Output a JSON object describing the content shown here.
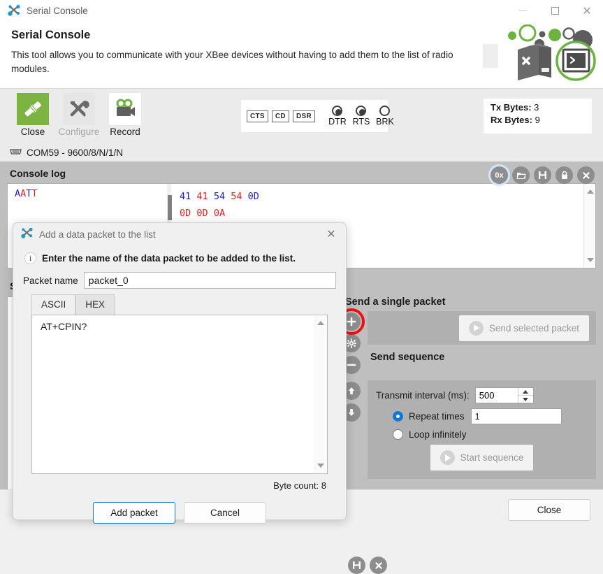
{
  "window": {
    "title": "Serial Console",
    "app_icon": "molecule-icon",
    "minimize": "minimize-icon",
    "maximize": "maximize-icon",
    "close": "close-icon"
  },
  "header": {
    "title": "Serial Console",
    "description": "This tool allows you to communicate with your XBee devices without having to add them to the list of radio modules.",
    "art_accent_green": "#6cb33f",
    "art_grey": "#5a5a5a"
  },
  "toolbar": {
    "buttons": [
      {
        "label": "Close",
        "icon": "disconnect-plug-icon",
        "enabled": true
      },
      {
        "label": "Configure",
        "icon": "tools-icon",
        "enabled": false
      },
      {
        "label": "Record",
        "icon": "video-camera-icon",
        "enabled": true
      }
    ],
    "signals": {
      "chips": [
        "CTS",
        "CD",
        "DSR"
      ],
      "leds": [
        {
          "label": "DTR",
          "on": true
        },
        {
          "label": "RTS",
          "on": true
        },
        {
          "label": "BRK",
          "on": false
        }
      ]
    },
    "counters": {
      "tx_label": "Tx Bytes:",
      "tx_value": "3",
      "rx_label": "Rx Bytes:",
      "rx_value": "9"
    },
    "port_status": "COM59 - 9600/8/N/1/N",
    "port_icon": "serial-port-icon"
  },
  "console_log": {
    "title": "Console log",
    "tools": [
      {
        "name": "hex-toggle",
        "glyph": "0x",
        "selected": true
      },
      {
        "name": "open-folder",
        "glyph": "folder",
        "selected": false
      },
      {
        "name": "save-log",
        "glyph": "floppy",
        "selected": false
      },
      {
        "name": "lock-scroll",
        "glyph": "lock",
        "selected": false
      },
      {
        "name": "clear-log",
        "glyph": "x",
        "selected": false
      }
    ],
    "ascii_chars": [
      {
        "ch": "A",
        "color": "#2020cf"
      },
      {
        "ch": "A",
        "color": "#e02020"
      },
      {
        "ch": "T",
        "color": "#2020cf"
      },
      {
        "ch": "T",
        "color": "#e02020"
      }
    ],
    "hex_lines": [
      [
        {
          "v": "41",
          "color": "#2020cf"
        },
        {
          "v": "41",
          "color": "#e02020"
        },
        {
          "v": "54",
          "color": "#2020cf"
        },
        {
          "v": "54",
          "color": "#e02020"
        },
        {
          "v": "0D",
          "color": "#2020cf"
        }
      ],
      [
        {
          "v": "0D",
          "color": "#e02020"
        },
        {
          "v": "0D",
          "color": "#e02020"
        },
        {
          "v": "0A",
          "color": "#e02020"
        }
      ]
    ]
  },
  "send_section": {
    "title": "Send packets",
    "tools": [
      {
        "name": "save-packets",
        "glyph": "floppy"
      },
      {
        "name": "close-packets",
        "glyph": "x"
      }
    ],
    "single_packet": {
      "title": "Send a single packet",
      "send_button": "Send selected packet",
      "vtools": [
        {
          "name": "add-packet",
          "glyph": "+",
          "highlighted": true
        },
        {
          "name": "edit-packet",
          "glyph": "gear",
          "highlighted": false
        },
        {
          "name": "remove-packet",
          "glyph": "-",
          "highlighted": false
        }
      ]
    },
    "sequence": {
      "title": "Send sequence",
      "interval_label": "Transmit interval (ms):",
      "interval_value": "500",
      "repeat_label": "Repeat times",
      "repeat_value": "1",
      "repeat_selected": true,
      "loop_label": "Loop infinitely",
      "loop_selected": false,
      "start_button": "Start sequence",
      "vtools": [
        {
          "name": "move-up",
          "glyph": "up"
        },
        {
          "name": "move-down",
          "glyph": "down"
        }
      ]
    }
  },
  "footer": {
    "close_label": "Close"
  },
  "dialog": {
    "title": "Add a data packet to the list",
    "icon": "molecule-icon",
    "close_icon": "close-icon",
    "info_text": "Enter the name of the data packet to be added to the list.",
    "name_label": "Packet name",
    "name_value": "packet_0",
    "tabs": [
      {
        "label": "ASCII",
        "active": true
      },
      {
        "label": "HEX",
        "active": false
      }
    ],
    "content_value": "AT+CPIN?",
    "byte_count": "Byte count: 8",
    "primary_button": "Add packet",
    "secondary_button": "Cancel"
  }
}
